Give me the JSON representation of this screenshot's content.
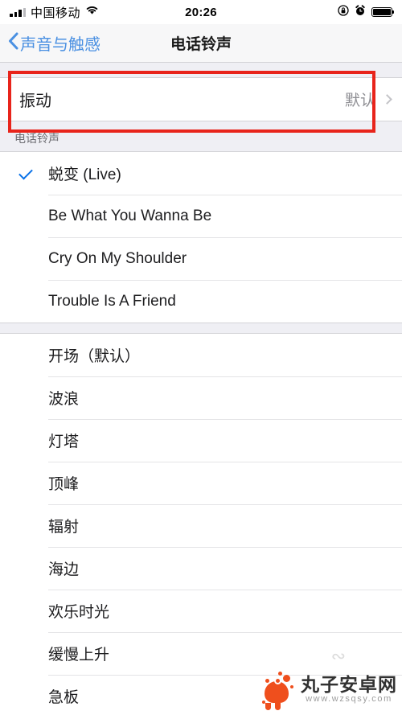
{
  "status_bar": {
    "carrier": "中国移动",
    "time": "20:26",
    "icons": [
      "signal-bars-icon",
      "wifi-icon",
      "rotation-lock-icon",
      "alarm-clock-icon",
      "battery-icon"
    ]
  },
  "nav": {
    "back_label": "声音与触感",
    "title": "电话铃声"
  },
  "vibration": {
    "label": "振动",
    "value": "默认"
  },
  "section": {
    "header": "电话铃声"
  },
  "custom_tones": [
    {
      "label": "蜕变 (Live)",
      "selected": true
    },
    {
      "label": "Be What You Wanna Be",
      "selected": false
    },
    {
      "label": "Cry On My Shoulder",
      "selected": false
    },
    {
      "label": "Trouble Is A Friend",
      "selected": false
    }
  ],
  "system_tones": [
    {
      "label": "开场（默认）"
    },
    {
      "label": "波浪"
    },
    {
      "label": "灯塔"
    },
    {
      "label": "顶峰"
    },
    {
      "label": "辐射"
    },
    {
      "label": "海边"
    },
    {
      "label": "欢乐时光"
    },
    {
      "label": "缓慢上升"
    },
    {
      "label": "急板"
    }
  ],
  "watermark": {
    "name": "丸子安卓网",
    "url": "www.wzsqsy.com"
  },
  "annotation": {
    "color": "#e8241b",
    "target": "振动"
  }
}
